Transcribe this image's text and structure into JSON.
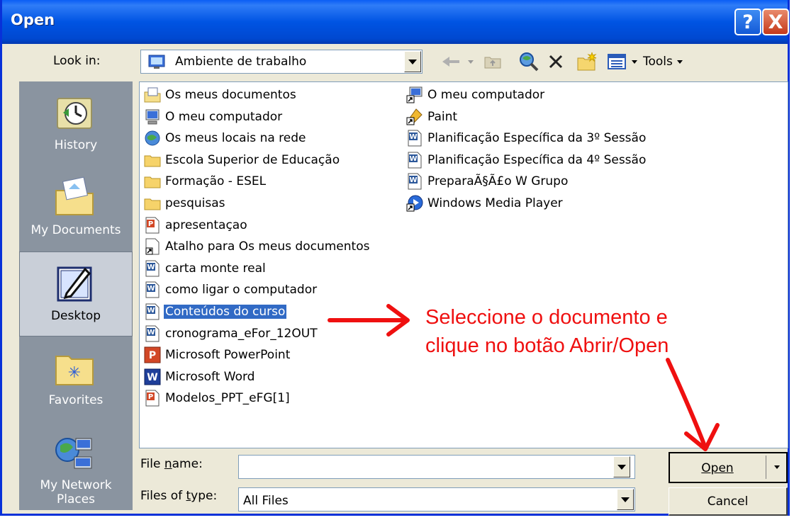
{
  "window": {
    "title": "Open"
  },
  "titlebar_buttons": {
    "help": "?",
    "close": "X"
  },
  "lookin": {
    "label": "Look in:",
    "value": "Ambiente de trabalho",
    "icon": "desktop-icon"
  },
  "toolbar": {
    "tools_label": "Tools"
  },
  "places": [
    {
      "label": "History",
      "icon": "history-icon"
    },
    {
      "label": "My Documents",
      "icon": "my-documents-icon"
    },
    {
      "label": "Desktop",
      "icon": "desktop-icon"
    },
    {
      "label": "Favorites",
      "icon": "favorites-icon"
    },
    {
      "label": "My Network Places",
      "icon": "network-places-icon"
    }
  ],
  "files_col1": [
    {
      "label": "Os meus documentos",
      "icon": "documents-folder-icon"
    },
    {
      "label": "O meu computador",
      "icon": "computer-icon"
    },
    {
      "label": "Os meus locais na rede",
      "icon": "network-icon"
    },
    {
      "label": "Escola Superior de Educação",
      "icon": "folder-icon"
    },
    {
      "label": "Formação - ESEL",
      "icon": "folder-icon"
    },
    {
      "label": "pesquisas",
      "icon": "folder-icon"
    },
    {
      "label": "apresentaçao",
      "icon": "powerpoint-doc-icon"
    },
    {
      "label": "Atalho para Os meus documentos",
      "icon": "shortcut-icon"
    },
    {
      "label": "carta monte real",
      "icon": "word-doc-icon"
    },
    {
      "label": "como ligar o computador",
      "icon": "word-doc-icon"
    },
    {
      "label": "Conteúdos do curso",
      "icon": "word-doc-icon"
    },
    {
      "label": "cronograma_eFor_12OUT",
      "icon": "word-doc-icon"
    },
    {
      "label": "Microsoft PowerPoint",
      "icon": "powerpoint-app-icon"
    },
    {
      "label": "Microsoft Word",
      "icon": "word-app-icon"
    },
    {
      "label": "Modelos_PPT_eFG[1]",
      "icon": "powerpoint-doc-icon"
    }
  ],
  "files_col2": [
    {
      "label": "O meu computador",
      "icon": "computer-shortcut-icon"
    },
    {
      "label": "Paint",
      "icon": "paint-icon"
    },
    {
      "label": "Planificação Específica da 3º Sessão",
      "icon": "word-doc-icon"
    },
    {
      "label": "Planificação Específica da 4º Sessão",
      "icon": "word-doc-icon"
    },
    {
      "label": "PreparaÃ§Ã£o W Grupo",
      "icon": "word-doc-icon"
    },
    {
      "label": "Windows Media Player",
      "icon": "media-player-icon"
    }
  ],
  "filename": {
    "label": "File name:",
    "value": ""
  },
  "filetype": {
    "label": "Files of type:",
    "value": "All Files"
  },
  "buttons": {
    "open": "Open",
    "cancel": "Cancel"
  },
  "annotation": {
    "line1": "Seleccione o documento e",
    "line2": "clique no botão Abrir/Open",
    "color": "#ef1010"
  },
  "colors": {
    "titlebar": "#0054e3",
    "selection": "#316ac5",
    "places_bar": "#8a94a0"
  }
}
